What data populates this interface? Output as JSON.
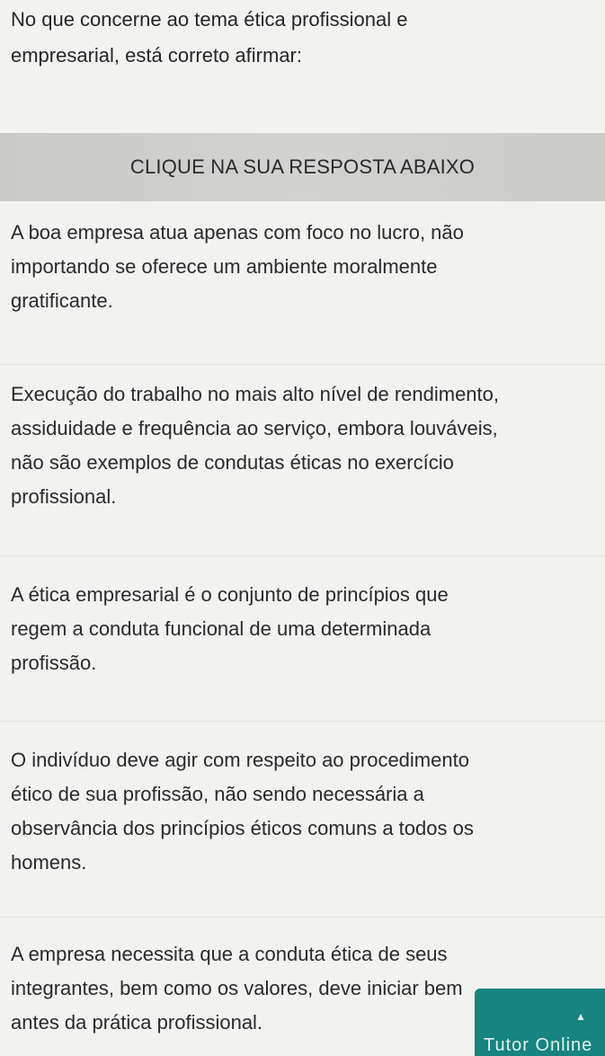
{
  "question": {
    "line1": "No que concerne ao tema ética profissional e",
    "line2": "empresarial, está correto afirmar:"
  },
  "banner": {
    "label": "CLIQUE NA SUA RESPOSTA ABAIXO"
  },
  "options": [
    {
      "lines": [
        "A boa empresa atua apenas com foco no lucro, não",
        "importando se oferece um ambiente moralmente",
        "gratificante."
      ]
    },
    {
      "lines": [
        "Execução do trabalho no mais alto nível de rendimento,",
        "assiduidade e frequência ao serviço, embora louváveis,",
        "não são exemplos de condutas éticas no exercício",
        "profissional."
      ]
    },
    {
      "lines": [
        "A ética empresarial é o conjunto de princípios que",
        "regem a conduta funcional de uma determinada",
        "profissão."
      ]
    },
    {
      "lines": [
        "O indivíduo deve agir com respeito ao procedimento",
        "ético de sua profissão, não sendo necessária a",
        "observância dos princípios éticos comuns a todos os",
        "homens."
      ]
    },
    {
      "lines": [
        "A empresa necessita que a conduta ética de seus",
        "integrantes, bem como os valores, deve iniciar bem",
        "antes da prática profissional."
      ]
    }
  ],
  "tutor": {
    "label": "Tutor Online"
  },
  "colors": {
    "background": "#f2f2f0",
    "banner": "#cfcfcd",
    "tutor_button": "#17847f"
  }
}
